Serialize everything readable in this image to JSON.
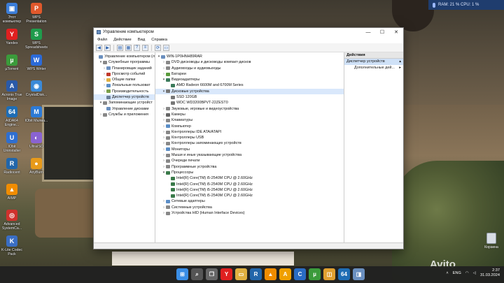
{
  "desktop": {
    "icons": [
      {
        "label": "Этот компьютер",
        "glyph": "▣",
        "color": "#3b7dd8"
      },
      {
        "label": "Yandex",
        "glyph": "Y",
        "color": "#e02020"
      },
      {
        "label": "µTorrent",
        "glyph": "µ",
        "color": "#3b9b3b"
      },
      {
        "label": "Acronis True Image",
        "glyph": "A",
        "color": "#2a5aa8"
      },
      {
        "label": "AIDA64 Engine...",
        "glyph": "64",
        "color": "#1e6db5"
      },
      {
        "label": "IObit Uninstaller",
        "glyph": "U",
        "color": "#2f6fd0"
      },
      {
        "label": "Radiocent",
        "glyph": "R",
        "color": "#2266aa"
      },
      {
        "label": "AIMP",
        "glyph": "▲",
        "color": "#f08c00"
      },
      {
        "label": "Advanced SystemCa...",
        "glyph": "◎",
        "color": "#d0312d"
      },
      {
        "label": "K-Lite Codec Pack",
        "glyph": "K",
        "color": "#3a6ec4"
      },
      {
        "label": "WPS Presentation",
        "glyph": "P",
        "color": "#e0582b"
      },
      {
        "label": "WPS Spreadsheets",
        "glyph": "S",
        "color": "#1f9b4c"
      },
      {
        "label": "WPS Writer",
        "glyph": "W",
        "color": "#2b6ad8"
      },
      {
        "label": "CrystalDisk...",
        "glyph": "◉",
        "color": "#3b8ad8"
      },
      {
        "label": "IObit Малва...",
        "glyph": "M",
        "color": "#2c7ad6"
      },
      {
        "label": "UltraISO",
        "glyph": "◐",
        "color": "#8a63d2"
      },
      {
        "label": "AnyBurn",
        "glyph": "●",
        "color": "#e89a1a"
      }
    ],
    "recycle_label": "Корзина"
  },
  "sysmon": {
    "text": "RAM: 21 %  CPU: 1 %"
  },
  "window": {
    "title": "Управление компьютером",
    "minimize_icon": "—",
    "maximize_icon": "☐",
    "close_icon": "✕",
    "menu": [
      "Файл",
      "Действие",
      "Вид",
      "Справка"
    ],
    "toolbar_icons": [
      "back-icon",
      "forward-icon",
      "folder-icon",
      "properties-icon",
      "help-icon",
      "list-icon",
      "scan-icon",
      "monitor-icon"
    ],
    "tree_left": [
      {
        "label": "Управление компьютером (л",
        "arrow": "",
        "indent": 0,
        "color": "#6a8fbf"
      },
      {
        "label": "Служебные программы",
        "arrow": "▾",
        "indent": 1,
        "color": "#888"
      },
      {
        "label": "Планировщик заданий",
        "arrow": "›",
        "indent": 2,
        "color": "#6a8fbf"
      },
      {
        "label": "Просмотр событий",
        "arrow": "›",
        "indent": 2,
        "color": "#c0392b"
      },
      {
        "label": "Общие папки",
        "arrow": "›",
        "indent": 2,
        "color": "#e0b040"
      },
      {
        "label": "Локальные пользоват",
        "arrow": "›",
        "indent": 2,
        "color": "#5b8ec7"
      },
      {
        "label": "Производительность",
        "arrow": "›",
        "indent": 2,
        "color": "#7aa04a"
      },
      {
        "label": "Диспетчер устройств",
        "arrow": "",
        "indent": 2,
        "color": "#6a7f9a",
        "selected": true
      },
      {
        "label": "Запоминающие устройст",
        "arrow": "▾",
        "indent": 1,
        "color": "#888"
      },
      {
        "label": "Управление дисками",
        "arrow": "",
        "indent": 2,
        "color": "#6a8fbf"
      },
      {
        "label": "Службы и приложения",
        "arrow": "›",
        "indent": 1,
        "color": "#888"
      }
    ],
    "tree_mid": [
      {
        "label": "WIN-1P0HNH89RAR",
        "arrow": "▾",
        "indent": 0,
        "color": "#6a8fbf"
      },
      {
        "label": "DVD-дисководы и дисководы компакт-дисков",
        "arrow": "›",
        "indent": 1,
        "color": "#888"
      },
      {
        "label": "Аудиовходы и аудиовыходы",
        "arrow": "›",
        "indent": 1,
        "color": "#888"
      },
      {
        "label": "Батареи",
        "arrow": "›",
        "indent": 1,
        "color": "#5a9b3c"
      },
      {
        "label": "Видеоадаптеры",
        "arrow": "▾",
        "indent": 1,
        "color": "#3a7a5a"
      },
      {
        "label": "AMD Radeon 6600M and 6700M Series",
        "arrow": "",
        "indent": 2,
        "color": "#3a7a5a"
      },
      {
        "label": "Дисковые устройства",
        "arrow": "▾",
        "indent": 1,
        "color": "#777",
        "selected": true
      },
      {
        "label": "SSD 120GB",
        "arrow": "",
        "indent": 2,
        "color": "#777"
      },
      {
        "label": "WDC WD3200BPVT-22ZEST0",
        "arrow": "",
        "indent": 2,
        "color": "#777"
      },
      {
        "label": "Звуковые, игровые и видеоустройства",
        "arrow": "›",
        "indent": 1,
        "color": "#888"
      },
      {
        "label": "Камеры",
        "arrow": "›",
        "indent": 1,
        "color": "#666"
      },
      {
        "label": "Клавиатуры",
        "arrow": "›",
        "indent": 1,
        "color": "#888"
      },
      {
        "label": "Компьютер",
        "arrow": "›",
        "indent": 1,
        "color": "#5b8ec7"
      },
      {
        "label": "Контроллеры IDE ATA/ATAPI",
        "arrow": "›",
        "indent": 1,
        "color": "#888"
      },
      {
        "label": "Контроллеры USB",
        "arrow": "›",
        "indent": 1,
        "color": "#888"
      },
      {
        "label": "Контроллеры запоминающих устройств",
        "arrow": "›",
        "indent": 1,
        "color": "#888"
      },
      {
        "label": "Мониторы",
        "arrow": "›",
        "indent": 1,
        "color": "#5b8ec7"
      },
      {
        "label": "Мыши и иные указывающие устройства",
        "arrow": "›",
        "indent": 1,
        "color": "#888"
      },
      {
        "label": "Очереди печати",
        "arrow": "›",
        "indent": 1,
        "color": "#888"
      },
      {
        "label": "Программные устройства",
        "arrow": "›",
        "indent": 1,
        "color": "#888"
      },
      {
        "label": "Процессоры",
        "arrow": "▾",
        "indent": 1,
        "color": "#3a7a4a"
      },
      {
        "label": "Intel(R) Core(TM) i5-2540M CPU @ 2.60GHz",
        "arrow": "",
        "indent": 2,
        "color": "#3a7a4a"
      },
      {
        "label": "Intel(R) Core(TM) i5-2540M CPU @ 2.60GHz",
        "arrow": "",
        "indent": 2,
        "color": "#3a7a4a"
      },
      {
        "label": "Intel(R) Core(TM) i5-2540M CPU @ 2.60GHz",
        "arrow": "",
        "indent": 2,
        "color": "#3a7a4a"
      },
      {
        "label": "Intel(R) Core(TM) i5-2540M CPU @ 2.60GHz",
        "arrow": "",
        "indent": 2,
        "color": "#3a7a4a"
      },
      {
        "label": "Сетевые адаптеры",
        "arrow": "›",
        "indent": 1,
        "color": "#5b8ec7"
      },
      {
        "label": "Системные устройства",
        "arrow": "›",
        "indent": 1,
        "color": "#888"
      },
      {
        "label": "Устройства HID (Human Interface Devices)",
        "arrow": "›",
        "indent": 1,
        "color": "#888"
      }
    ],
    "actions": {
      "header": "Действия",
      "section": "Диспетчер устройств",
      "item": "Дополнительные дей..."
    }
  },
  "taskbar": {
    "apps": [
      {
        "name": "start",
        "glyph": "⊞",
        "color": "#3a8ee6"
      },
      {
        "name": "search",
        "glyph": "⌕",
        "color": "#555"
      },
      {
        "name": "task-view",
        "glyph": "❐",
        "color": "#666"
      },
      {
        "name": "yandex",
        "glyph": "Y",
        "color": "#e02020"
      },
      {
        "name": "files",
        "glyph": "▭",
        "color": "#e0b040"
      },
      {
        "name": "radiocent",
        "glyph": "R",
        "color": "#2266aa"
      },
      {
        "name": "vlc",
        "glyph": "▲",
        "color": "#f08c00"
      },
      {
        "name": "aimp",
        "glyph": "A",
        "color": "#f0a000"
      },
      {
        "name": "ccleaner",
        "glyph": "C",
        "color": "#2a6cc4"
      },
      {
        "name": "torrent",
        "glyph": "µ",
        "color": "#3b9b3b"
      },
      {
        "name": "explorer",
        "glyph": "◫",
        "color": "#e0a030"
      },
      {
        "name": "aida64",
        "glyph": "64",
        "color": "#1e6db5"
      },
      {
        "name": "computer-management",
        "glyph": "◨",
        "color": "#6a8fbf"
      }
    ],
    "lang": "ENG",
    "time": "2:37",
    "date": "31.03.2024"
  },
  "watermark": "Avito"
}
